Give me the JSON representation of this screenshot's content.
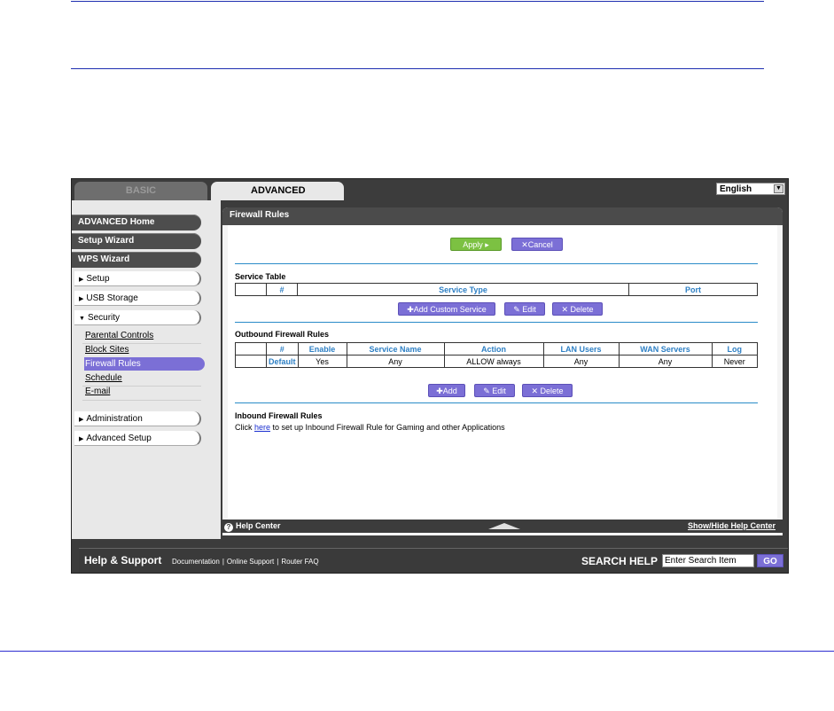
{
  "tabs": {
    "basic": "BASIC",
    "advanced": "ADVANCED"
  },
  "language": {
    "selected": "English"
  },
  "sidebar": {
    "advanced_home": "ADVANCED Home",
    "setup_wizard": "Setup Wizard",
    "wps_wizard": "WPS Wizard",
    "setup": "Setup",
    "usb_storage": "USB Storage",
    "security": "Security",
    "security_items": [
      "Parental Controls",
      "Block Sites",
      "Firewall Rules",
      "Schedule",
      "E-mail"
    ],
    "administration": "Administration",
    "advanced_setup": "Advanced Setup"
  },
  "panel": {
    "title": "Firewall Rules",
    "apply_label": "Apply ▸",
    "cancel_label": "Cancel"
  },
  "service_table": {
    "title": "Service Table",
    "headers": [
      "",
      "#",
      "Service Type",
      "Port"
    ],
    "add_label": "Add Custom Service",
    "edit_label": "Edit",
    "delete_label": "Delete"
  },
  "outbound": {
    "title": "Outbound Firewall Rules",
    "headers": [
      "",
      "#",
      "Enable",
      "Service Name",
      "Action",
      "LAN Users",
      "WAN Servers",
      "Log"
    ],
    "row": [
      "",
      "Default",
      "Yes",
      "Any",
      "ALLOW always",
      "Any",
      "Any",
      "Never"
    ],
    "add_label": "Add",
    "edit_label": "Edit",
    "delete_label": "Delete"
  },
  "inbound": {
    "title": "Inbound Firewall Rules",
    "text_before": "Click ",
    "link": "here",
    "text_after": " to set up Inbound Firewall Rule for Gaming and other Applications"
  },
  "help_bar": {
    "help_center": "Help Center",
    "show_hide": "Show/Hide Help Center"
  },
  "footer": {
    "help_support": "Help & Support",
    "links": [
      "Documentation",
      "Online Support",
      "Router FAQ"
    ],
    "search_label": "SEARCH HELP",
    "search_value": "Enter Search Item",
    "go_label": "GO"
  },
  "colors": {
    "accent_purple": "#7b6fd6",
    "apply_green": "#7cc142",
    "header_blue": "#2d7fc4",
    "rule_blue": "#1f2fb0"
  }
}
